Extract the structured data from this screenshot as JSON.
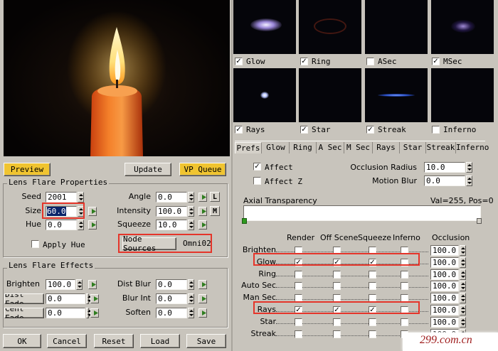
{
  "preview": {
    "scene": "candle-flame"
  },
  "buttons": {
    "preview": "Preview",
    "update": "Update",
    "vp_queue": "VP Queue",
    "ok": "OK",
    "cancel": "Cancel",
    "reset": "Reset",
    "load": "Load",
    "save": "Save"
  },
  "lens_props": {
    "title": "Lens Flare Properties",
    "seed_label": "Seed",
    "seed": "2001",
    "size_label": "Size",
    "size": "60.0",
    "hue_label": "Hue",
    "hue": "0.0",
    "angle_label": "Angle",
    "angle": "0.0",
    "intensity_label": "Intensity",
    "intensity": "100.0",
    "squeeze_label": "Squeeze",
    "squeeze": "10.0",
    "lock_l": "L",
    "lock_m": "M",
    "apply_hue": "Apply Hue",
    "node_sources": "Node Sources",
    "node_value": "Omni02"
  },
  "lens_effects": {
    "title": "Lens Flare Effects",
    "brighten_label": "Brighten",
    "brighten": "100.0",
    "dist_fade_label": "Dist Fade",
    "dist_fade": "0.0",
    "cent_fade_label": "Cent Fade",
    "cent_fade": "0.0",
    "dist_blur_label": "Dist Blur",
    "dist_blur": "0.0",
    "blur_int_label": "Blur Int",
    "blur_int": "0.0",
    "soften_label": "Soften",
    "soften": "0.0"
  },
  "thumbnails": [
    {
      "label": "Glow",
      "checked": true
    },
    {
      "label": "Ring",
      "checked": true
    },
    {
      "label": "ASec",
      "checked": false
    },
    {
      "label": "MSec",
      "checked": true
    },
    {
      "label": "Rays",
      "checked": true
    },
    {
      "label": "Star",
      "checked": true
    },
    {
      "label": "Streak",
      "checked": true
    },
    {
      "label": "Inferno",
      "checked": false
    }
  ],
  "tabs": [
    "Prefs",
    "Glow",
    "Ring",
    "A Sec",
    "M Sec",
    "Rays",
    "Star",
    "Streak",
    "Inferno"
  ],
  "prefs": {
    "affect": "Affect",
    "affect_z": "Affect Z",
    "occlusion_radius_label": "Occlusion Radius",
    "occlusion_radius": "10.0",
    "motion_blur_label": "Motion Blur",
    "motion_blur": "0.0",
    "axial_label": "Axial Transparency",
    "axial_info": "Val=255, Pos=0"
  },
  "table": {
    "headers": {
      "render": "Render",
      "off_scene": "Off Scene",
      "squeeze": "Squeeze",
      "inferno": "Inferno",
      "occlusion": "Occlusion"
    },
    "rows": [
      {
        "label": "Brighten",
        "render": false,
        "off": false,
        "squeeze": false,
        "inferno": false,
        "occ": "100.0"
      },
      {
        "label": "Glow",
        "render": true,
        "off": true,
        "squeeze": true,
        "inferno": false,
        "occ": "100.0"
      },
      {
        "label": "Ring",
        "render": false,
        "off": false,
        "squeeze": false,
        "inferno": false,
        "occ": "100.0"
      },
      {
        "label": "Auto Sec",
        "render": false,
        "off": false,
        "squeeze": false,
        "inferno": false,
        "occ": "100.0"
      },
      {
        "label": "Man Sec",
        "render": false,
        "off": false,
        "squeeze": false,
        "inferno": false,
        "occ": "100.0"
      },
      {
        "label": "Rays",
        "render": true,
        "off": true,
        "squeeze": true,
        "inferno": false,
        "occ": "100.0"
      },
      {
        "label": "Star",
        "render": false,
        "off": false,
        "squeeze": false,
        "inferno": false,
        "occ": "100.0"
      },
      {
        "label": "Streak",
        "render": false,
        "off": false,
        "squeeze": false,
        "inferno": false,
        "occ": "100.0"
      }
    ]
  },
  "watermark": "299.com.cn",
  "colors": {
    "highlight": "#e5352a",
    "accent_button": "#f0c430",
    "check_green": "#2e7d1f"
  }
}
